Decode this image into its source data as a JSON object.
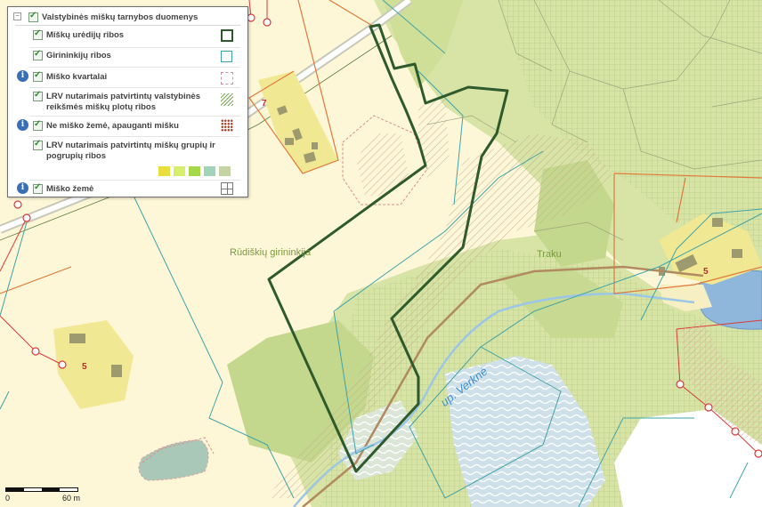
{
  "legend": {
    "group_title": "Valstybinės miškų tarnybos duomenys",
    "expander": "−",
    "info_glyph": "i",
    "items": [
      {
        "label": "Miškų urėdijų ribos",
        "symbol": "thick-green-square-icon",
        "info": false
      },
      {
        "label": "Girininkijų ribos",
        "symbol": "teal-square-icon",
        "info": false
      },
      {
        "label": "Miško kvartalai",
        "symbol": "dashed-pink-square-icon",
        "info": true
      },
      {
        "label_line1": "LRV nutarimais patvirtintų valstybinės",
        "label_line2": "reikšmės miškų plotų ribos",
        "symbol": "hatched-green-square-icon",
        "info": false
      },
      {
        "label": "Ne miško žemė, apauganti mišku",
        "symbol": "brown-dot-grid-icon",
        "info": true
      },
      {
        "label_line1": "LRV nutarimais patvirtintų miškų grupių ir",
        "label_line2": "pogrupių ribos",
        "symbol": "group-swatches",
        "info": false
      },
      {
        "label": "Miško žemė",
        "symbol": "grid-square-icon",
        "info": true
      }
    ],
    "group_swatch_colors": [
      "#e6df3c",
      "#d6ee6a",
      "#a6d94a",
      "#9fd4b8",
      "#c3d3a3"
    ]
  },
  "map": {
    "labels": {
      "forestry": "Rūdiškių girininkija",
      "traku": "Traku",
      "river": "up. Verknė"
    },
    "parcel_numbers": [
      "5",
      "7",
      "5"
    ],
    "scale": {
      "zero": "0",
      "distance": "60 m"
    }
  },
  "colors": {
    "background": "#fdf7d8",
    "forest": "#d7e4a6",
    "forest_dark": "#c3d78d",
    "urediju_border": "#2e5a2c",
    "girininkiju_border": "#3ea3a8",
    "kvartalai": "#d98f8f",
    "parcel_line": "#e0793a",
    "river": "#8fbfe0",
    "lake": "#8fb7dc",
    "building": "#9c9a6e"
  }
}
